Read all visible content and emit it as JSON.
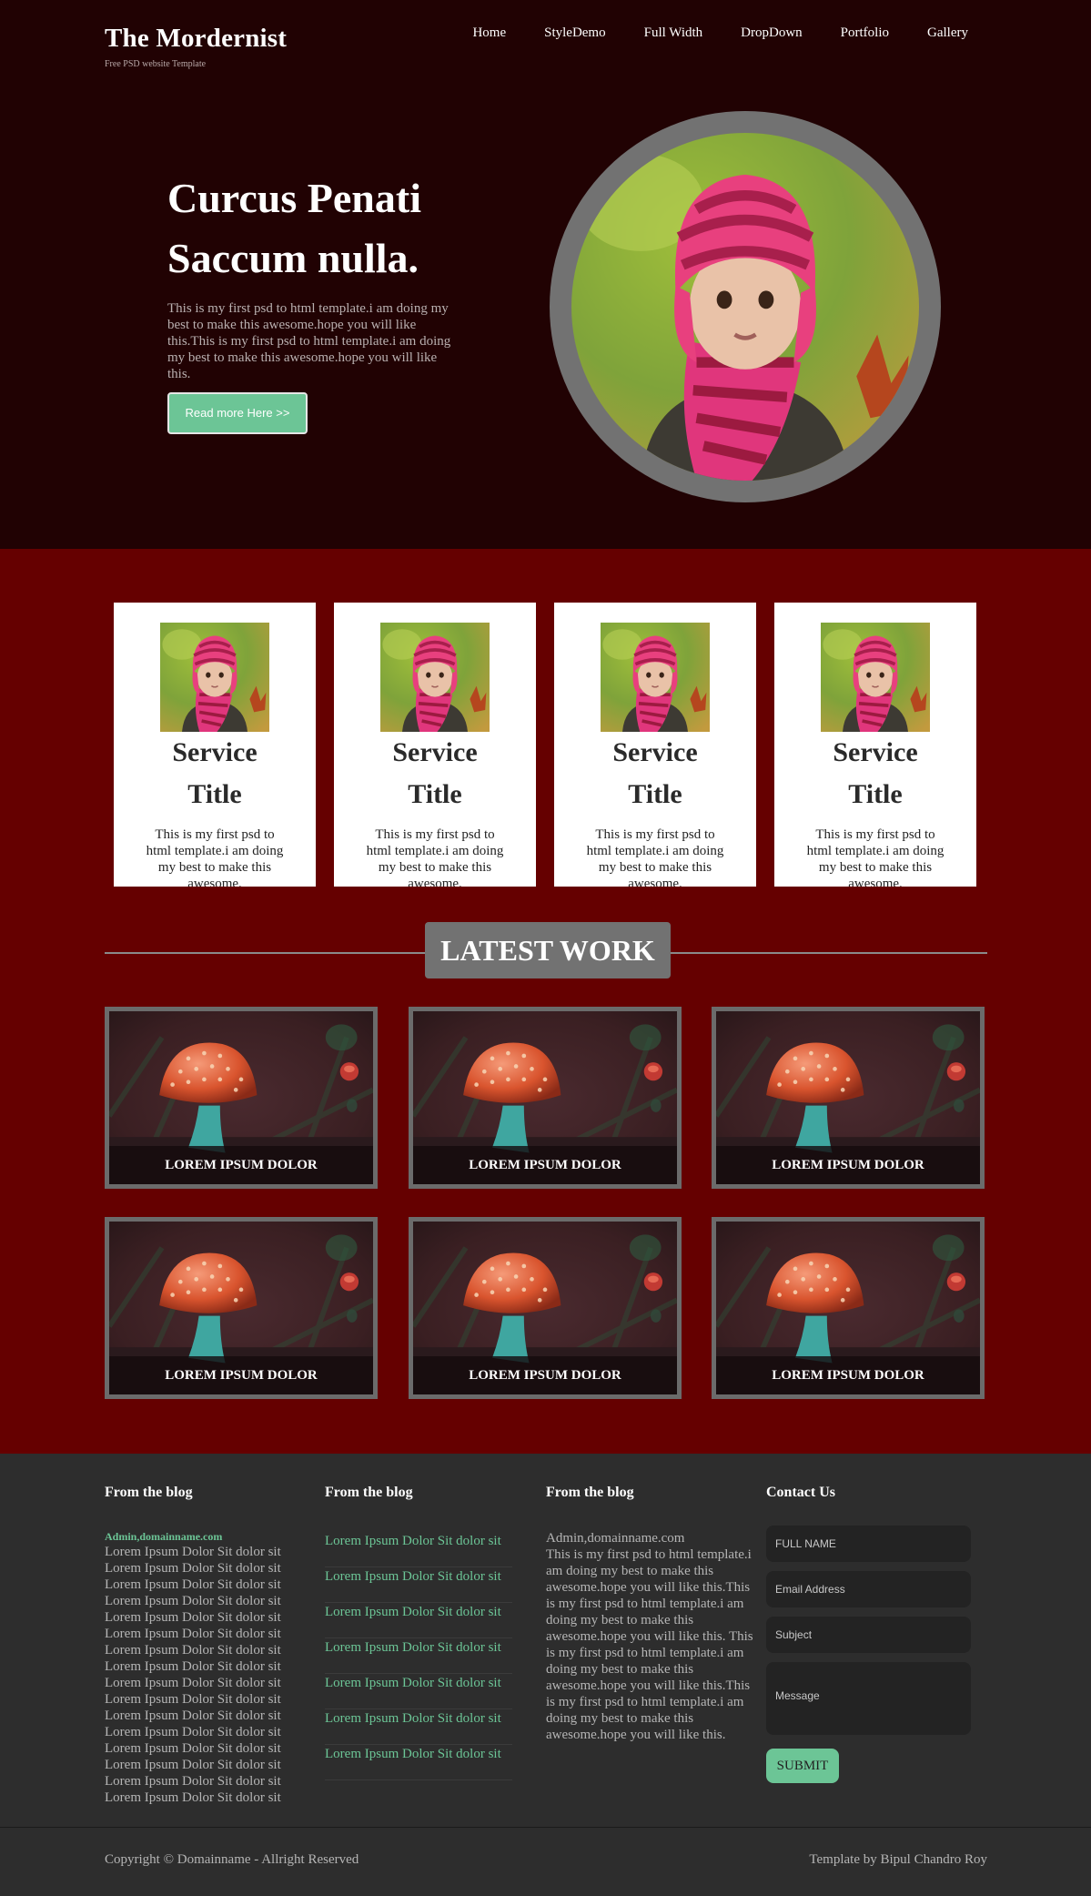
{
  "header": {
    "brand_title": "The Mordernist",
    "brand_tagline": "Free PSD website Template",
    "nav": [
      "Home",
      "StyleDemo",
      "Full Width",
      "DropDown",
      "Portfolio",
      "Gallery"
    ]
  },
  "hero": {
    "heading_line1": "Curcus Penati",
    "heading_line2": "Saccum nulla.",
    "body": "This is my first psd to html template.i am doing my best to make this awesome.hope you will like this.This is my first psd to html template.i am doing my best to make this awesome.hope you will like this.",
    "button_label": "Read more Here >>"
  },
  "services": [
    {
      "title_line1": "Service",
      "title_line2": "Title",
      "text": "This is my first psd to html template.i am doing my best to make this awesome."
    },
    {
      "title_line1": "Service",
      "title_line2": "Title",
      "text": "This is my first psd to html template.i am doing my best to make this awesome."
    },
    {
      "title_line1": "Service",
      "title_line2": "Title",
      "text": "This is my first psd to html template.i am doing my best to make this awesome."
    },
    {
      "title_line1": "Service",
      "title_line2": "Title",
      "text": "This is my first psd to html template.i am doing my best to make this awesome."
    }
  ],
  "latest_work": {
    "heading": "LATEST WORK",
    "items": [
      "LOREM IPSUM DOLOR",
      "LOREM IPSUM DOLOR",
      "LOREM IPSUM DOLOR",
      "LOREM IPSUM DOLOR",
      "LOREM IPSUM DOLOR",
      "LOREM IPSUM DOLOR"
    ]
  },
  "footer": {
    "col1": {
      "title": "From the blog",
      "author": "Admin,domainname.com",
      "lines": [
        "Lorem Ipsum Dolor Sit dolor sit",
        "Lorem Ipsum Dolor Sit dolor sit",
        "Lorem Ipsum Dolor Sit dolor sit",
        "Lorem Ipsum Dolor Sit dolor sit",
        "Lorem Ipsum Dolor Sit dolor sit",
        "Lorem Ipsum Dolor Sit dolor sit",
        "Lorem Ipsum Dolor Sit dolor sit",
        "Lorem Ipsum Dolor Sit dolor sit",
        "Lorem Ipsum Dolor Sit dolor sit",
        "Lorem Ipsum Dolor Sit dolor sit",
        "Lorem Ipsum Dolor Sit dolor sit",
        "Lorem Ipsum Dolor Sit dolor sit",
        "Lorem Ipsum Dolor Sit dolor sit",
        "Lorem Ipsum Dolor Sit dolor sit",
        "Lorem Ipsum Dolor Sit dolor sit",
        "Lorem Ipsum Dolor Sit dolor sit"
      ]
    },
    "col2": {
      "title": "From the blog",
      "links": [
        "Lorem Ipsum Dolor Sit dolor sit",
        "Lorem Ipsum Dolor Sit dolor sit",
        "Lorem Ipsum Dolor Sit dolor sit",
        "Lorem Ipsum Dolor Sit dolor sit",
        "Lorem Ipsum Dolor Sit dolor sit",
        "Lorem Ipsum Dolor Sit dolor sit",
        "Lorem Ipsum Dolor Sit dolor sit"
      ]
    },
    "col3": {
      "title": "From the blog",
      "author": "Admin,domainname.com",
      "text": "This is my first psd to html template.i am doing my best to make this awesome.hope you will like this.This is my first psd to html template.i am doing my best to make this awesome.hope you will like this. This is my first psd to html template.i am doing my best to make this awesome.hope you will like this.This is my first psd to html template.i am doing my best to make this awesome.hope you will like this."
    },
    "contact": {
      "title": "Contact Us",
      "name_placeholder": "FULL NAME",
      "email_placeholder": "Email Address",
      "subject_placeholder": "Subject",
      "message_placeholder": "Message",
      "submit_label": "SUBMIT"
    },
    "copyright": "Copyright © Domainname - Allright Reserved",
    "credit": "Template by Bipul Chandro Roy"
  },
  "colors": {
    "hero_bg": "#210203",
    "main_bg": "#650000",
    "footer_bg": "#2d2d2d",
    "accent_green": "#6cc596",
    "frame_gray": "#727272"
  }
}
